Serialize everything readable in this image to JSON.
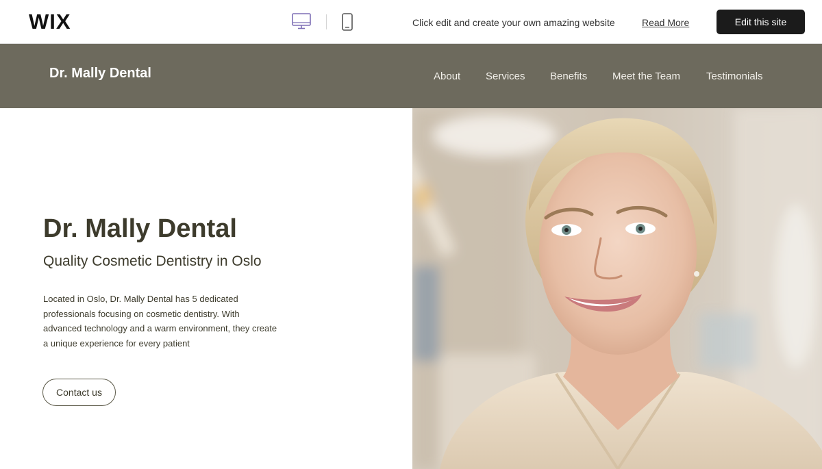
{
  "wix_bar": {
    "logo": "WIX",
    "desktop_icon": "desktop-monitor-icon",
    "mobile_icon": "mobile-phone-icon",
    "cta_text": "Click edit and create your own amazing website",
    "read_more": "Read More",
    "edit_button": "Edit this site"
  },
  "site": {
    "brand": "Dr. Mally Dental",
    "nav": [
      "About",
      "Services",
      "Benefits",
      "Meet the Team",
      "Testimonials"
    ]
  },
  "hero": {
    "title": "Dr. Mally Dental",
    "subtitle": "Quality Cosmetic Dentistry in Oslo",
    "description": "Located in Oslo, Dr. Mally Dental has 5 dedicated professionals focusing on cosmetic dentistry. With advanced technology and a warm environment, they create a unique experience for every patient",
    "contact_button": "Contact us"
  },
  "colors": {
    "header_bg": "#6d6a5d",
    "heading_text": "#3d3b2c",
    "edit_button_bg": "#1b1b1b",
    "desktop_icon_accent": "#7e6fb5"
  }
}
